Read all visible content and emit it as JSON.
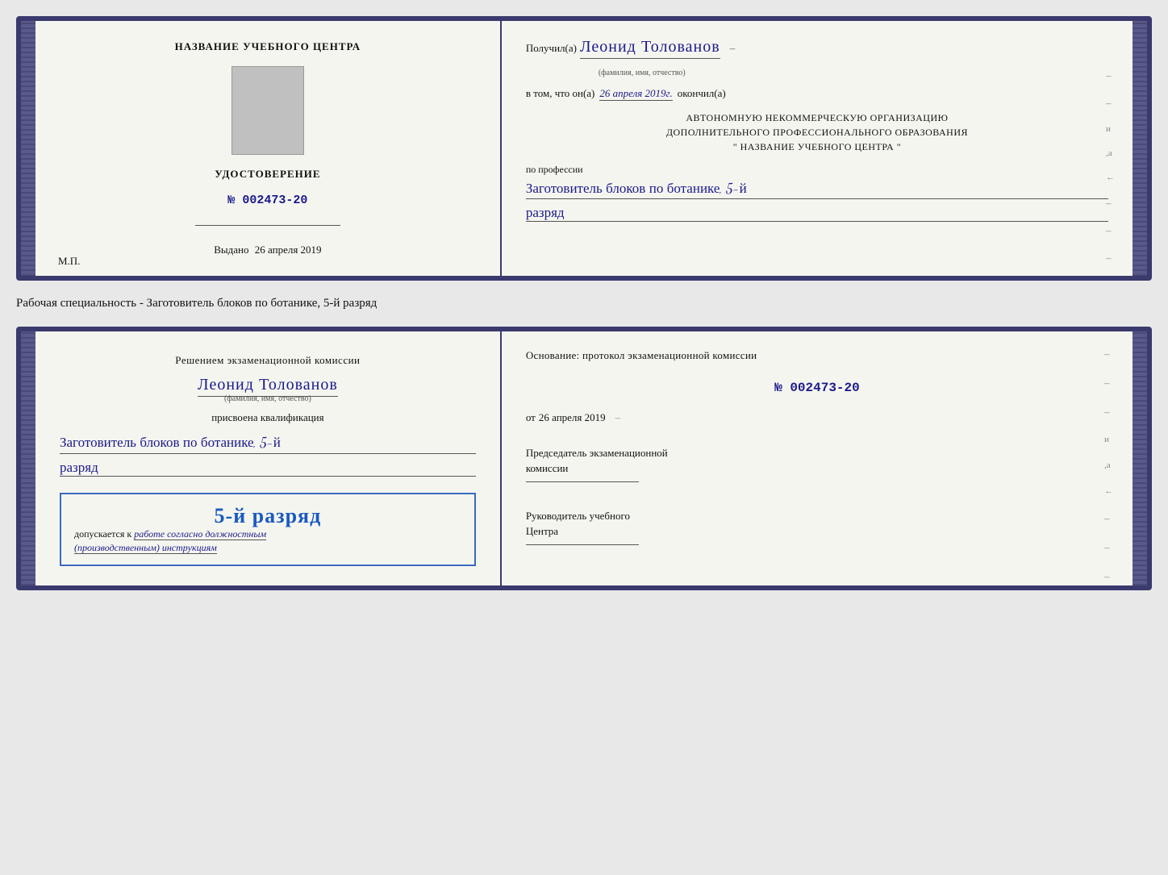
{
  "top_document": {
    "left": {
      "center_title": "НАЗВАНИЕ УЧЕБНОГО ЦЕНТРА",
      "udostoverenie_title": "УДОСТОВЕРЕНИЕ",
      "number_prefix": "№",
      "number": "002473-20",
      "vydano_label": "Выдано",
      "vydano_date": "26 апреля 2019",
      "mp_label": "М.П."
    },
    "right": {
      "poluchil_prefix": "Получил(а)",
      "name": "Леонид Толованов",
      "name_subtitle": "(фамилия, имя, отчество)",
      "vtom_prefix": "в том, что он(а)",
      "vtom_date": "26 апреля 2019г.",
      "vtom_suffix": "окончил(а)",
      "org_line1": "АВТОНОМНУЮ НЕКОММЕРЧЕСКУЮ ОРГАНИЗАЦИЮ",
      "org_line2": "ДОПОЛНИТЕЛЬНОГО ПРОФЕССИОНАЛЬНОГО ОБРАЗОВАНИЯ",
      "org_line3": "\"  НАЗВАНИЕ УЧЕБНОГО ЦЕНТРА  \"",
      "po_professii": "по профессии",
      "profession": "Заготовитель блоков по ботанике, 5-й",
      "razryad": "разряд"
    }
  },
  "specialty_label": "Рабочая специальность - Заготовитель блоков по ботанике, 5-й разряд",
  "bottom_document": {
    "left": {
      "resheniem": "Решением экзаменационной комиссии",
      "name": "Леонид Толованов",
      "name_subtitle": "(фамилия, имя, отчество)",
      "prisvoyena": "присвоена квалификация",
      "qualification": "Заготовитель блоков по ботанике, 5-й",
      "razryad": "разряд",
      "stamp_text": "5-й разряд",
      "dopuskaetsya": "допускается к",
      "rabote_text": "работе согласно должностным",
      "instruktsiyam": "(производственным) инструкциям"
    },
    "right": {
      "osnovanie": "Основание: протокол экзаменационной комиссии",
      "number_prefix": "№",
      "number": "002473-20",
      "ot_prefix": "от",
      "ot_date": "26 апреля 2019",
      "predsedatel_line1": "Председатель экзаменационной",
      "predsedatel_line2": "комиссии",
      "rukovoditel_line1": "Руководитель учебного",
      "rukovoditel_line2": "Центра"
    }
  }
}
